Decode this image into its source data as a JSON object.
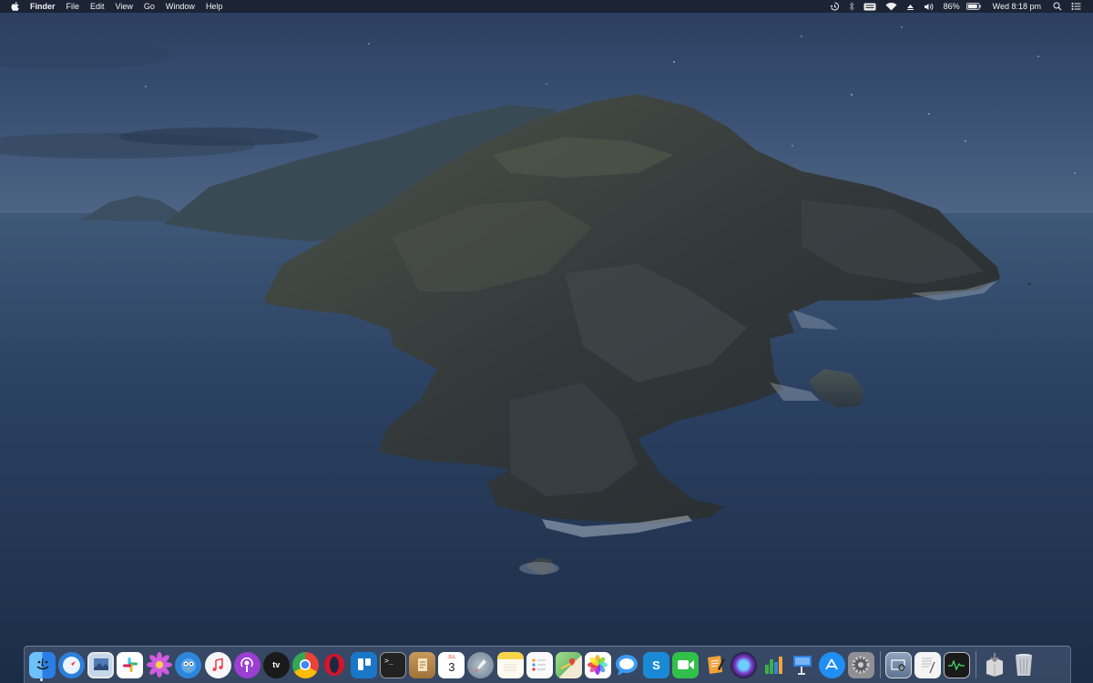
{
  "menubar": {
    "app_name": "Finder",
    "items": [
      "File",
      "Edit",
      "View",
      "Go",
      "Window",
      "Help"
    ],
    "battery_percent": "86%",
    "clock": "Wed 8:18 pm",
    "status_icons": [
      "time-machine-icon",
      "bluetooth-icon",
      "keyboard-input-icon",
      "wifi-icon",
      "airplay-icon",
      "volume-icon",
      "battery-icon",
      "spotlight-icon",
      "notification-center-icon"
    ]
  },
  "desktop": {
    "wallpaper": "night-island-coastline"
  },
  "dock": {
    "calendar_month": "JUL",
    "calendar_day": "3",
    "apps": [
      {
        "name": "finder-icon",
        "color": "#3b8ff0"
      },
      {
        "name": "safari-icon",
        "color": "#2d7fd9"
      },
      {
        "name": "preview-icon",
        "color": "#6a8fb8"
      },
      {
        "name": "slack-icon",
        "color": "#ffffff"
      },
      {
        "name": "flower-app-icon",
        "color": "#c84bd6"
      },
      {
        "name": "tweetbot-icon",
        "color": "#2f86d9"
      },
      {
        "name": "music-icon",
        "color": "#f5f5f7"
      },
      {
        "name": "podcasts-icon",
        "color": "#9b3fd1"
      },
      {
        "name": "apple-tv-icon",
        "color": "#1a1a1a"
      },
      {
        "name": "chrome-icon",
        "color": "#ffffff"
      },
      {
        "name": "opera-icon",
        "color": "#d7132a"
      },
      {
        "name": "trello-icon",
        "color": "#1a76c9"
      },
      {
        "name": "terminal-icon",
        "color": "#222222"
      },
      {
        "name": "notefile-icon",
        "color": "#b98a4a"
      },
      {
        "name": "calendar-icon",
        "color": "#ffffff"
      },
      {
        "name": "launchpad-icon",
        "color": "#8a9aa8"
      },
      {
        "name": "notes-icon",
        "color": "#f7e58a"
      },
      {
        "name": "reminders-icon",
        "color": "#fafafa"
      },
      {
        "name": "maps-icon",
        "color": "#7dc47b"
      },
      {
        "name": "photos-icon",
        "color": "#ffffff"
      },
      {
        "name": "messages-icon",
        "color": "#3a9cf5"
      },
      {
        "name": "skype-icon",
        "color": "#1a8ad6"
      },
      {
        "name": "facetime-icon",
        "color": "#31c04a"
      },
      {
        "name": "pages-icon",
        "color": "#f3a23a"
      },
      {
        "name": "siri-icon",
        "color": "#2a2a4a"
      },
      {
        "name": "numbers-icon",
        "color": "#f5f5f5"
      },
      {
        "name": "keynote-icon",
        "color": "#2f7fe0"
      },
      {
        "name": "app-store-icon",
        "color": "#1f8ef5"
      },
      {
        "name": "system-preferences-icon",
        "color": "#8f8f94"
      }
    ],
    "utilities": [
      {
        "name": "screenshot-icon",
        "color": "#6f87a8"
      },
      {
        "name": "textedit-icon",
        "color": "#f4f4f4"
      },
      {
        "name": "activity-monitor-icon",
        "color": "#1a1a1a"
      }
    ],
    "trailing": [
      {
        "name": "installer-icon",
        "color": "#d8d8d8"
      },
      {
        "name": "trash-icon",
        "color": "#c8ccd2"
      }
    ]
  }
}
